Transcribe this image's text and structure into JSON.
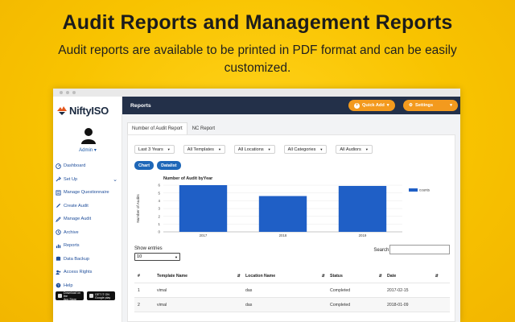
{
  "headline": "Audit Reports and Management Reports",
  "subline": "Audit reports are available to be printed in PDF format and can be easily customized.",
  "sidebar": {
    "logo_text": "NiftyISO",
    "user_label": "Admin",
    "items": [
      {
        "label": "Dashboard",
        "icon": "dashboard-icon"
      },
      {
        "label": "Set Up",
        "icon": "setup-icon",
        "expandable": true
      },
      {
        "label": "Manage Questionnaire",
        "icon": "questionnaire-icon"
      },
      {
        "label": "Create Audit",
        "icon": "create-audit-icon"
      },
      {
        "label": "Manage Audit",
        "icon": "manage-audit-icon"
      },
      {
        "label": "Archive",
        "icon": "archive-icon"
      },
      {
        "label": "Reports",
        "icon": "reports-icon"
      },
      {
        "label": "Data Backup",
        "icon": "backup-icon"
      },
      {
        "label": "Access Rights",
        "icon": "access-rights-icon"
      },
      {
        "label": "Help",
        "icon": "help-icon"
      }
    ],
    "stores": [
      {
        "top": "Download on the",
        "name": "App Store"
      },
      {
        "top": "GET IT ON",
        "name": "Google play"
      }
    ]
  },
  "topbar": {
    "title": "Reports",
    "quick_add": "Quick Add",
    "settings": "Settings"
  },
  "tabs": [
    "Number of Audit Report",
    "NC Report"
  ],
  "filters": [
    "Last 3 Years",
    "All Templates",
    "All Locations",
    "All Categories",
    "All Audiors"
  ],
  "view_buttons": [
    "Chart",
    "Datalist"
  ],
  "chart_data": {
    "type": "bar",
    "title": "Number of Audit byYear",
    "ylabel": "Number of Audits",
    "xlabel": "",
    "categories": [
      "2017",
      "2018",
      "2019"
    ],
    "series": [
      {
        "name": "counts",
        "values": [
          6,
          4.6,
          5.9
        ]
      }
    ],
    "ylim": [
      0,
      6
    ],
    "yticks": [
      "0",
      "1",
      "2",
      "3",
      "4",
      "5",
      "6"
    ],
    "legend": "right",
    "color": "#1f5fc6"
  },
  "table_controls": {
    "show_entries_label": "Show entries",
    "entries_value": "10",
    "search_label": "Search:"
  },
  "table": {
    "headers": [
      "#",
      "Template Name",
      "Location Name",
      "Status",
      "Date"
    ],
    "rows": [
      [
        "1",
        "vimal",
        "das",
        "Completed",
        "2017-02-15"
      ],
      [
        "2",
        "vimal",
        "das",
        "Completed",
        "2018-01-09"
      ]
    ]
  },
  "colors": {
    "background": "#f8c300",
    "topbar": "#233049",
    "accent_orange": "#f39a1e",
    "accent_blue": "#1e67b8"
  }
}
